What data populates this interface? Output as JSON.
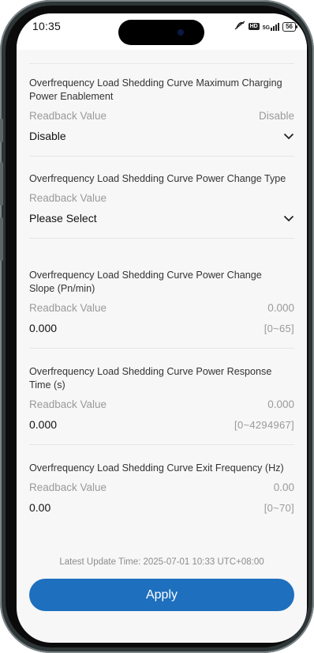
{
  "status_bar": {
    "time": "10:35",
    "network_label": "5G",
    "hd_label": "HD",
    "battery": "56",
    "icons": [
      "mute-icon",
      "hd-icon",
      "signal-5g-icon",
      "battery-icon"
    ]
  },
  "params": [
    {
      "title": "Overfrequency Load Shedding Curve Maximum Charging Power Enablement",
      "readback_label": "Readback Value",
      "readback_value": "Disable",
      "value": "Disable",
      "control": "dropdown",
      "icon": "chevron-down-icon"
    },
    {
      "title": "Overfrequency Load Shedding Curve Power Change Type",
      "readback_label": "Readback Value",
      "readback_value": "",
      "value": "Please Select",
      "control": "dropdown",
      "icon": "chevron-down-icon"
    },
    {
      "title": "Overfrequency Load Shedding Curve Power Change Slope (Pn/min)",
      "readback_label": "Readback Value",
      "readback_value": "0.000",
      "value": "0.000",
      "range": "[0~65]",
      "control": "input"
    },
    {
      "title": "Overfrequency Load Shedding Curve Power Response Time (s)",
      "readback_label": "Readback Value",
      "readback_value": "0.000",
      "value": "0.000",
      "range": "[0~4294967]",
      "control": "input"
    },
    {
      "title": "Overfrequency Load Shedding Curve Exit Frequency (Hz)",
      "readback_label": "Readback Value",
      "readback_value": "0.00",
      "value": "0.00",
      "range": "[0~70]",
      "control": "input"
    }
  ],
  "footer": {
    "update_time": "Latest Update Time: 2025-07-01 10:33 UTC+08:00",
    "apply_label": "Apply"
  },
  "colors": {
    "accent": "#1e6fbe",
    "background": "#f7f7f7",
    "muted_text": "#9a9a9a"
  }
}
